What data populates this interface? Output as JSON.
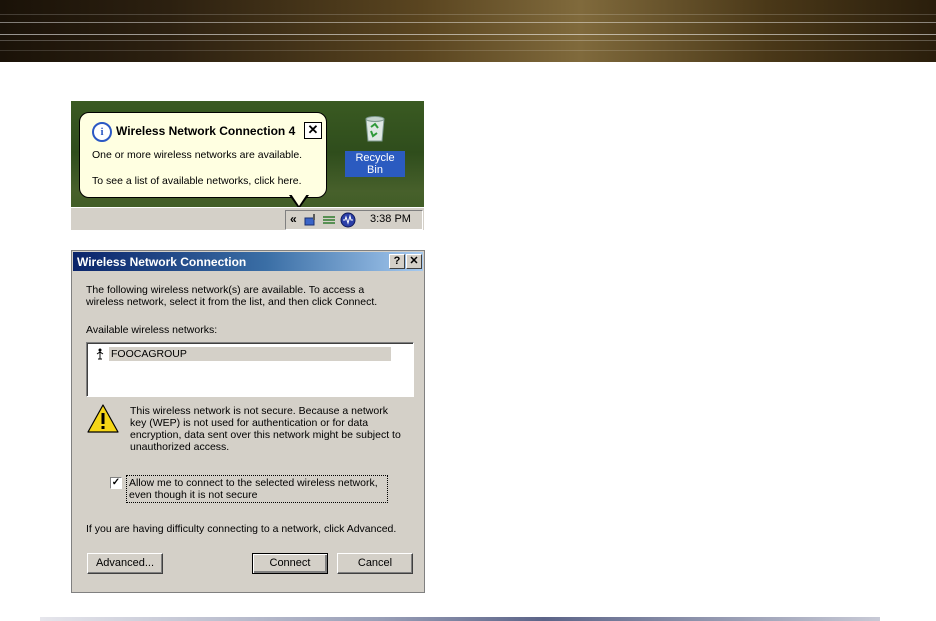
{
  "colors": {
    "balloon_bg": "#ffffe1",
    "titlebar_start": "#0a246a",
    "titlebar_end": "#a6caf0",
    "dialog_bg": "#d4d0c8",
    "selection_blue": "#2b5bc0"
  },
  "balloon": {
    "icon": "info-icon",
    "title": "Wireless Network Connection 4",
    "close_label": "✕",
    "line1": "One or more wireless networks are available.",
    "line2": "To see a list of available networks, click here."
  },
  "desktop": {
    "recycle_bin_label": "Recycle Bin"
  },
  "tray": {
    "chevron": "«",
    "icons": [
      "wireless-network-icon",
      "network-cable-icon",
      "audio-icon"
    ],
    "time": "3:38 PM"
  },
  "dialog": {
    "title": "Wireless Network Connection",
    "help_label": "?",
    "close_label": "✕",
    "intro_line1": "The following wireless network(s) are available. To access a",
    "intro_line2": "wireless network, select it from the list, and then click Connect.",
    "list_label": "Available wireless networks:",
    "networks": [
      {
        "name": "FOOCAGROUP",
        "icon": "antenna-icon",
        "selected": true
      }
    ],
    "warning_line1": "This wireless network is not secure. Because a network",
    "warning_line2": "key (WEP) is not used for authentication or for data",
    "warning_line3": "encryption, data sent over this network might be subject to",
    "warning_line4": "unauthorized access.",
    "checkbox_checked": true,
    "checkbox_mark": "✓",
    "checkbox_line1": "Allow me to connect to the selected wireless network,",
    "checkbox_line2": "even though it is not secure",
    "help_text": "If you are having difficulty connecting to a network, click Advanced.",
    "advanced_label": "Advanced...",
    "connect_label": "Connect",
    "cancel_label": "Cancel"
  }
}
